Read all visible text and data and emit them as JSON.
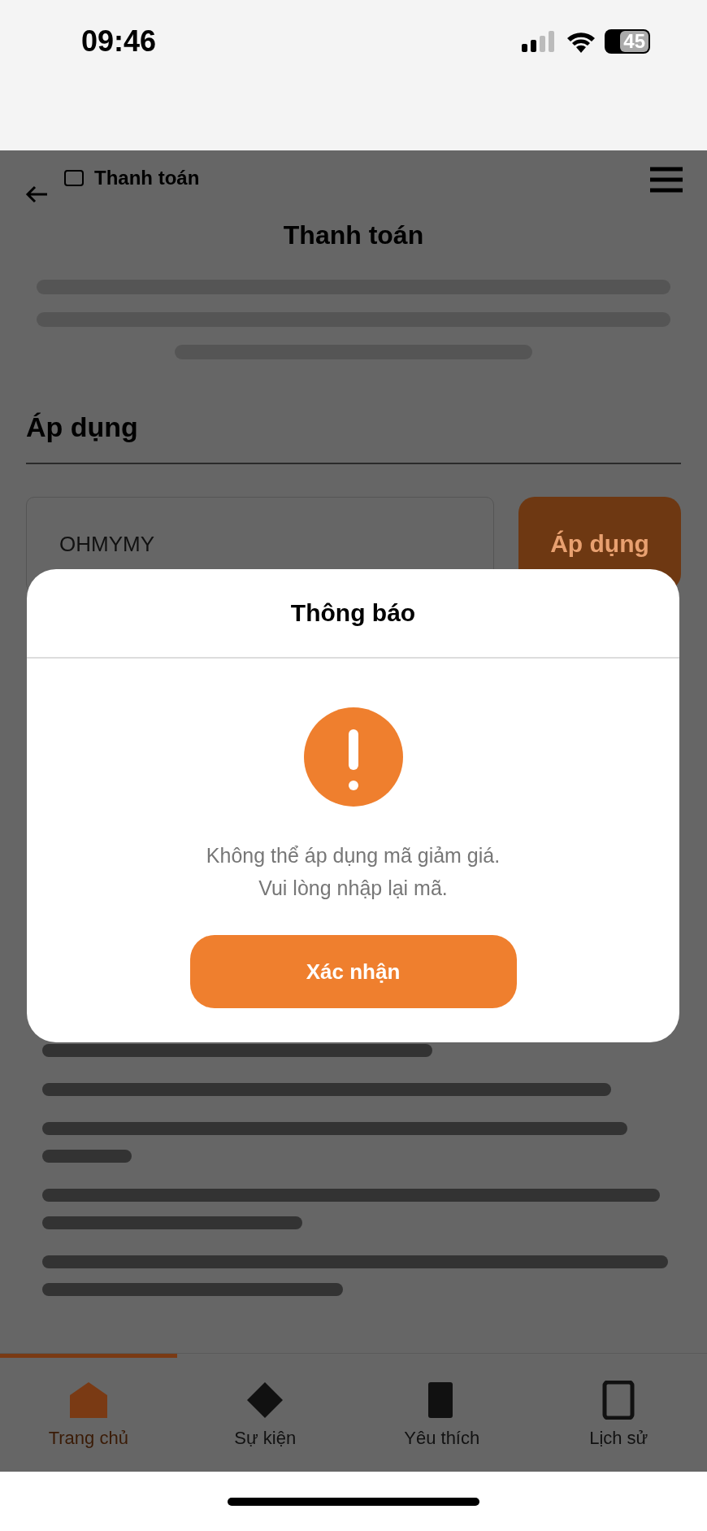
{
  "status_bar": {
    "time": "09:46",
    "battery": "45"
  },
  "header": {
    "title": "Thanh toán"
  },
  "page": {
    "heading": "Thanh toán",
    "section_title": "Áp dụng",
    "coupon": {
      "value": "OHMYMY"
    },
    "apply_button": "Áp dụng"
  },
  "tab_bar": [
    {
      "label": "Trang chủ",
      "kind": "home",
      "selected": true
    },
    {
      "label": "Sự kiện",
      "kind": "event",
      "selected": false
    },
    {
      "label": "Yêu thích",
      "kind": "favorite",
      "selected": false
    },
    {
      "label": "Lịch sử",
      "kind": "history",
      "selected": false
    }
  ],
  "dialog": {
    "title": "Thông báo",
    "message": [
      "Không thể áp dụng mã giảm giá.",
      "Vui lòng nhập lại mã."
    ],
    "button": "Xác nhận"
  }
}
